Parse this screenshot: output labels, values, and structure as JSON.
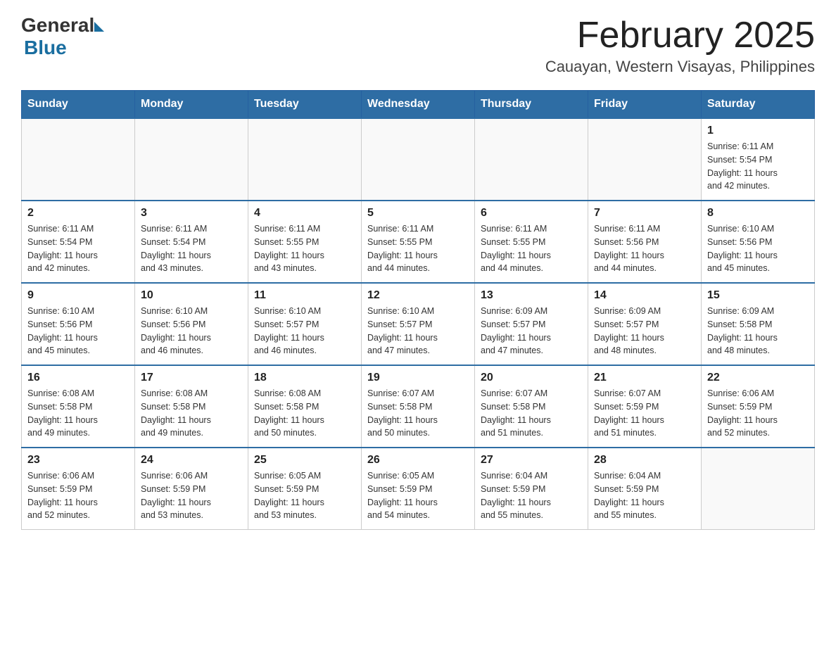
{
  "logo": {
    "text_general": "General",
    "text_blue": "Blue"
  },
  "title": "February 2025",
  "subtitle": "Cauayan, Western Visayas, Philippines",
  "weekdays": [
    "Sunday",
    "Monday",
    "Tuesday",
    "Wednesday",
    "Thursday",
    "Friday",
    "Saturday"
  ],
  "weeks": [
    [
      {
        "day": "",
        "info": ""
      },
      {
        "day": "",
        "info": ""
      },
      {
        "day": "",
        "info": ""
      },
      {
        "day": "",
        "info": ""
      },
      {
        "day": "",
        "info": ""
      },
      {
        "day": "",
        "info": ""
      },
      {
        "day": "1",
        "info": "Sunrise: 6:11 AM\nSunset: 5:54 PM\nDaylight: 11 hours\nand 42 minutes."
      }
    ],
    [
      {
        "day": "2",
        "info": "Sunrise: 6:11 AM\nSunset: 5:54 PM\nDaylight: 11 hours\nand 42 minutes."
      },
      {
        "day": "3",
        "info": "Sunrise: 6:11 AM\nSunset: 5:54 PM\nDaylight: 11 hours\nand 43 minutes."
      },
      {
        "day": "4",
        "info": "Sunrise: 6:11 AM\nSunset: 5:55 PM\nDaylight: 11 hours\nand 43 minutes."
      },
      {
        "day": "5",
        "info": "Sunrise: 6:11 AM\nSunset: 5:55 PM\nDaylight: 11 hours\nand 44 minutes."
      },
      {
        "day": "6",
        "info": "Sunrise: 6:11 AM\nSunset: 5:55 PM\nDaylight: 11 hours\nand 44 minutes."
      },
      {
        "day": "7",
        "info": "Sunrise: 6:11 AM\nSunset: 5:56 PM\nDaylight: 11 hours\nand 44 minutes."
      },
      {
        "day": "8",
        "info": "Sunrise: 6:10 AM\nSunset: 5:56 PM\nDaylight: 11 hours\nand 45 minutes."
      }
    ],
    [
      {
        "day": "9",
        "info": "Sunrise: 6:10 AM\nSunset: 5:56 PM\nDaylight: 11 hours\nand 45 minutes."
      },
      {
        "day": "10",
        "info": "Sunrise: 6:10 AM\nSunset: 5:56 PM\nDaylight: 11 hours\nand 46 minutes."
      },
      {
        "day": "11",
        "info": "Sunrise: 6:10 AM\nSunset: 5:57 PM\nDaylight: 11 hours\nand 46 minutes."
      },
      {
        "day": "12",
        "info": "Sunrise: 6:10 AM\nSunset: 5:57 PM\nDaylight: 11 hours\nand 47 minutes."
      },
      {
        "day": "13",
        "info": "Sunrise: 6:09 AM\nSunset: 5:57 PM\nDaylight: 11 hours\nand 47 minutes."
      },
      {
        "day": "14",
        "info": "Sunrise: 6:09 AM\nSunset: 5:57 PM\nDaylight: 11 hours\nand 48 minutes."
      },
      {
        "day": "15",
        "info": "Sunrise: 6:09 AM\nSunset: 5:58 PM\nDaylight: 11 hours\nand 48 minutes."
      }
    ],
    [
      {
        "day": "16",
        "info": "Sunrise: 6:08 AM\nSunset: 5:58 PM\nDaylight: 11 hours\nand 49 minutes."
      },
      {
        "day": "17",
        "info": "Sunrise: 6:08 AM\nSunset: 5:58 PM\nDaylight: 11 hours\nand 49 minutes."
      },
      {
        "day": "18",
        "info": "Sunrise: 6:08 AM\nSunset: 5:58 PM\nDaylight: 11 hours\nand 50 minutes."
      },
      {
        "day": "19",
        "info": "Sunrise: 6:07 AM\nSunset: 5:58 PM\nDaylight: 11 hours\nand 50 minutes."
      },
      {
        "day": "20",
        "info": "Sunrise: 6:07 AM\nSunset: 5:58 PM\nDaylight: 11 hours\nand 51 minutes."
      },
      {
        "day": "21",
        "info": "Sunrise: 6:07 AM\nSunset: 5:59 PM\nDaylight: 11 hours\nand 51 minutes."
      },
      {
        "day": "22",
        "info": "Sunrise: 6:06 AM\nSunset: 5:59 PM\nDaylight: 11 hours\nand 52 minutes."
      }
    ],
    [
      {
        "day": "23",
        "info": "Sunrise: 6:06 AM\nSunset: 5:59 PM\nDaylight: 11 hours\nand 52 minutes."
      },
      {
        "day": "24",
        "info": "Sunrise: 6:06 AM\nSunset: 5:59 PM\nDaylight: 11 hours\nand 53 minutes."
      },
      {
        "day": "25",
        "info": "Sunrise: 6:05 AM\nSunset: 5:59 PM\nDaylight: 11 hours\nand 53 minutes."
      },
      {
        "day": "26",
        "info": "Sunrise: 6:05 AM\nSunset: 5:59 PM\nDaylight: 11 hours\nand 54 minutes."
      },
      {
        "day": "27",
        "info": "Sunrise: 6:04 AM\nSunset: 5:59 PM\nDaylight: 11 hours\nand 55 minutes."
      },
      {
        "day": "28",
        "info": "Sunrise: 6:04 AM\nSunset: 5:59 PM\nDaylight: 11 hours\nand 55 minutes."
      },
      {
        "day": "",
        "info": ""
      }
    ]
  ]
}
